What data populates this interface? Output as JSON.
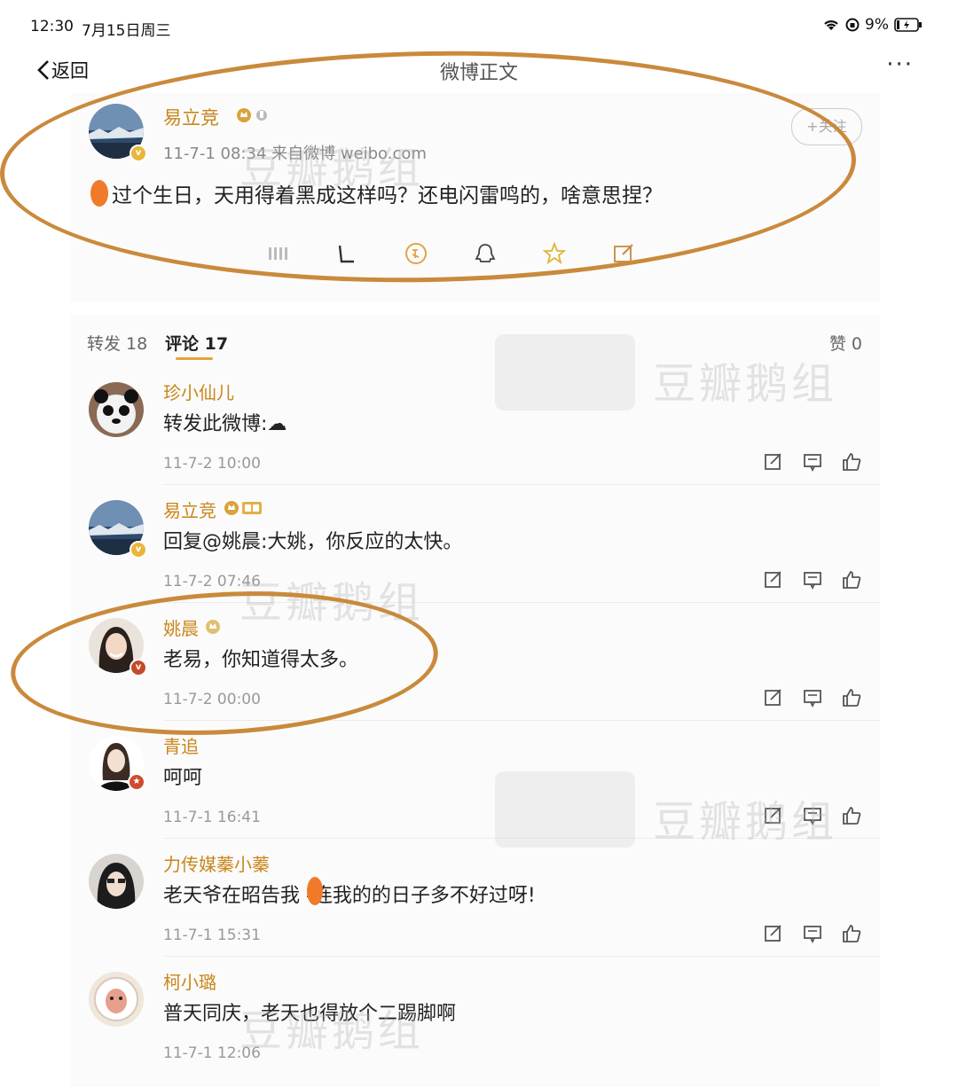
{
  "status_bar": {
    "time": "12:30",
    "date": "7月15日周三",
    "battery": "9%"
  },
  "nav": {
    "back_label": "返回",
    "title": "微博正文",
    "more_label": "···"
  },
  "post": {
    "author": "易立竞",
    "meta": "11-7-1 08:34  来自微博 weibo.com",
    "text": "过个生日，天用得着黑成这样吗？还电闪雷鸣的，啥意思捏？",
    "follow_label": "+关注"
  },
  "tabs": {
    "repost": "转发 18",
    "comment": "评论 17",
    "like": "赞 0"
  },
  "watermark": "豆瓣鹅组",
  "comments": [
    {
      "name": "珍小仙儿",
      "text": "转发此微博:☁",
      "time": "11-7-2 10:00"
    },
    {
      "name": "易立竞",
      "text": "回复@姚晨:大姚，你反应的太快。",
      "time": "11-7-2 07:46"
    },
    {
      "name": "姚晨",
      "text": "老易，你知道得太多。",
      "time": "11-7-2 00:00"
    },
    {
      "name": "青追",
      "text": "呵呵",
      "time": "11-7-1 16:41"
    },
    {
      "name": "力传媒蓁小蓁",
      "text": "老天爷在昭告我  -连我的的日子多不好过呀!",
      "time": "11-7-1 15:31"
    },
    {
      "name": "柯小璐",
      "text": "普天同庆，老天也得放个二踢脚啊",
      "time": "11-7-1 12:06"
    }
  ],
  "colors": {
    "name": "#c9851a",
    "circle": "#c98a3c",
    "accent": "#e3a43a"
  }
}
